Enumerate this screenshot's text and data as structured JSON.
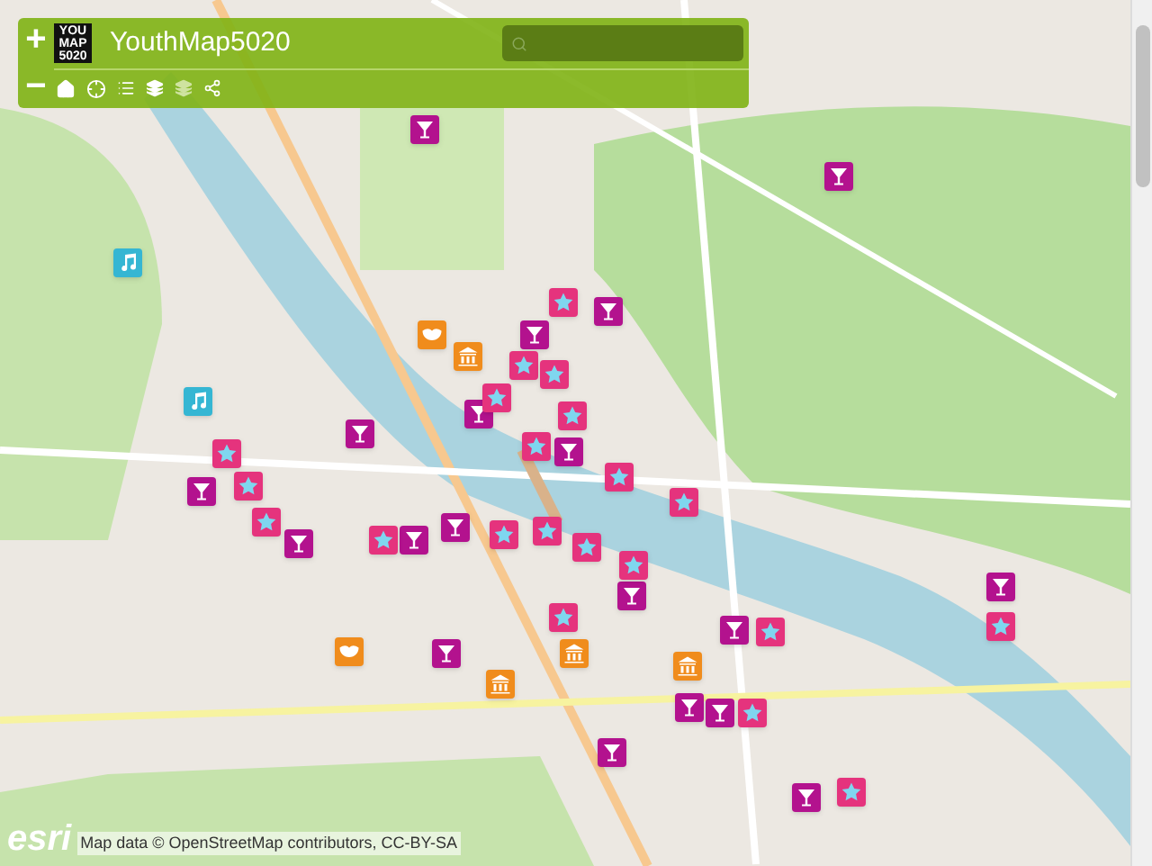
{
  "zoom": {
    "in": "+",
    "out": "−"
  },
  "header": {
    "logo": [
      "YOU",
      "MAP",
      "5020"
    ],
    "title": "YouthMap5020"
  },
  "markers": [
    {
      "kind": "bar"
    },
    {
      "kind": "bar"
    },
    {
      "kind": "bar"
    },
    {
      "kind": "bar"
    },
    {
      "kind": "bar"
    },
    {
      "kind": "bar"
    },
    {
      "kind": "bar"
    },
    {
      "kind": "bar"
    },
    {
      "kind": "bar"
    },
    {
      "kind": "bar"
    },
    {
      "kind": "bar"
    },
    {
      "kind": "bar"
    },
    {
      "kind": "bar"
    },
    {
      "kind": "bar"
    },
    {
      "kind": "bar"
    },
    {
      "kind": "bar"
    },
    {
      "kind": "bar"
    },
    {
      "kind": "bar"
    },
    {
      "kind": "bar"
    },
    {
      "kind": "star"
    },
    {
      "kind": "star"
    },
    {
      "kind": "star"
    },
    {
      "kind": "star"
    },
    {
      "kind": "star"
    },
    {
      "kind": "star"
    },
    {
      "kind": "star"
    },
    {
      "kind": "star"
    },
    {
      "kind": "star"
    },
    {
      "kind": "star"
    },
    {
      "kind": "star"
    },
    {
      "kind": "star"
    },
    {
      "kind": "star"
    },
    {
      "kind": "star"
    },
    {
      "kind": "star"
    },
    {
      "kind": "star"
    },
    {
      "kind": "star"
    },
    {
      "kind": "star"
    },
    {
      "kind": "star"
    },
    {
      "kind": "star"
    },
    {
      "kind": "star"
    },
    {
      "kind": "museum"
    },
    {
      "kind": "museum"
    },
    {
      "kind": "museum"
    },
    {
      "kind": "museum"
    },
    {
      "kind": "mask"
    },
    {
      "kind": "mask"
    },
    {
      "kind": "music"
    },
    {
      "kind": "music"
    }
  ],
  "attribution": {
    "logo": "esri",
    "text": "Map data © OpenStreetMap contributors, CC-BY-SA"
  }
}
